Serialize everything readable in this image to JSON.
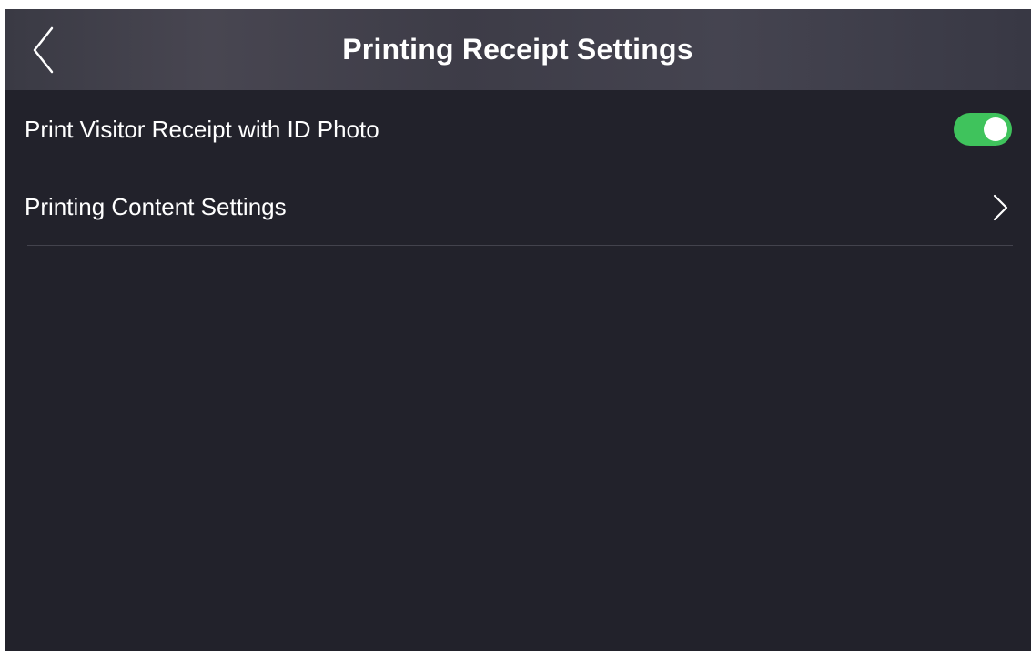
{
  "header": {
    "title": "Printing Receipt Settings",
    "back_icon": "chevron-left-icon"
  },
  "settings": {
    "items": [
      {
        "label": "Print Visitor Receipt with ID Photo",
        "control": "toggle",
        "enabled": true
      },
      {
        "label": "Printing Content Settings",
        "control": "chevron-right-icon"
      }
    ]
  },
  "colors": {
    "background": "#22222b",
    "toggle_on": "#3fc35c",
    "text": "#ffffff"
  }
}
